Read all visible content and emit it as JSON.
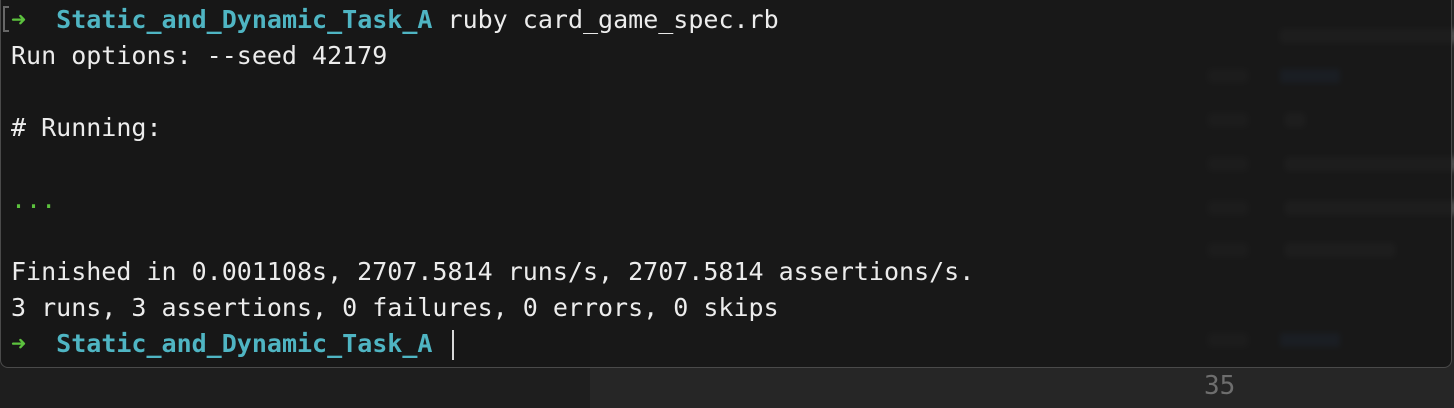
{
  "terminal": {
    "prompt_symbol": "➜",
    "cwd": "Static_and_Dynamic_Task_A",
    "command": "ruby card_game_spec.rb",
    "output": {
      "run_options": "Run options: --seed 42179",
      "running": "# Running:",
      "progress": "...",
      "finished": "Finished in 0.001108s, 2707.5814 runs/s, 2707.5814 assertions/s.",
      "summary": "3 runs, 3 assertions, 0 failures, 0 errors, 0 skips"
    },
    "final_prompt": {
      "prompt_symbol": "➜",
      "cwd": "Static_and_Dynamic_Task_A"
    }
  },
  "editor": {
    "visible_line_number": "35"
  },
  "colors": {
    "prompt_arrow": "#5cc23e",
    "cwd": "#4fb5c3",
    "text": "#ececec",
    "background": "#161616"
  }
}
